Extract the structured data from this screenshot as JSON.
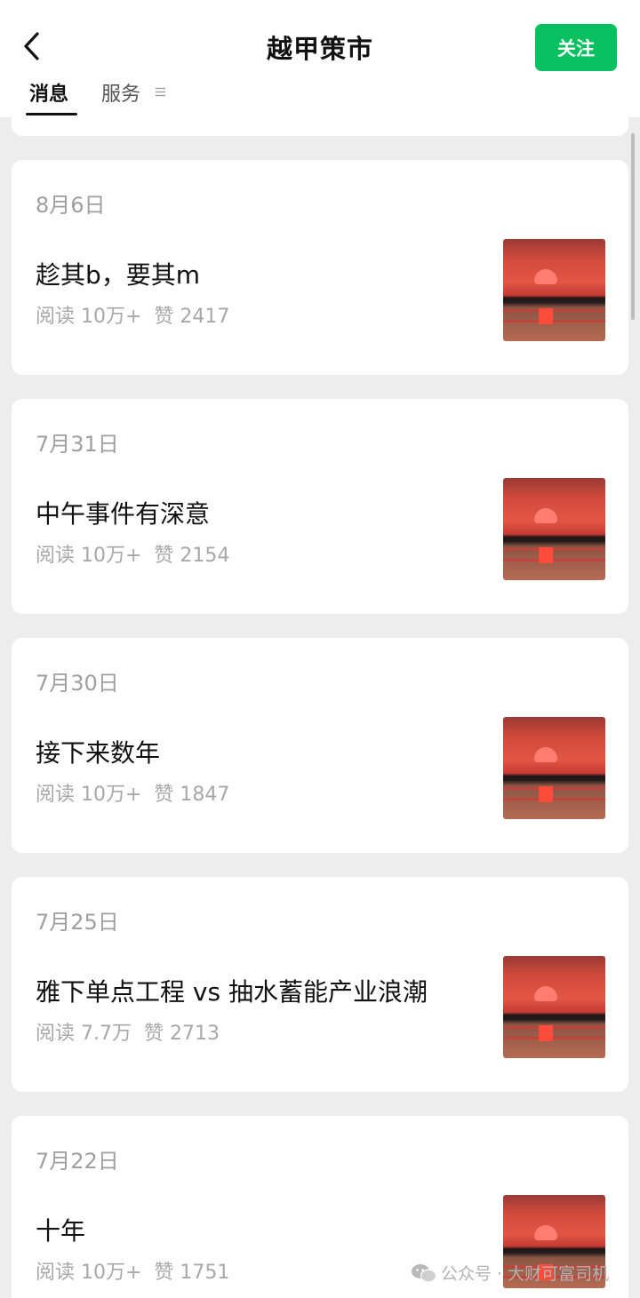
{
  "header": {
    "title": "越甲策市",
    "follow_label": "关注",
    "icons": {
      "back": "chevron-left-icon",
      "menu": "menu-lines-icon"
    }
  },
  "tabs": [
    {
      "label": "消息",
      "active": true
    },
    {
      "label": "服务",
      "active": false
    }
  ],
  "articles": [
    {
      "date": "8月6日",
      "title": "趁其b，要其m",
      "reads": "阅读 10万+",
      "likes": "赞 2417"
    },
    {
      "date": "7月31日",
      "title": "中午事件有深意",
      "reads": "阅读 10万+",
      "likes": "赞 2154"
    },
    {
      "date": "7月30日",
      "title": "接下来数年",
      "reads": "阅读 10万+",
      "likes": "赞 1847"
    },
    {
      "date": "7月25日",
      "title": "雅下单点工程 vs 抽水蓄能产业浪潮",
      "reads": "阅读 7.7万",
      "likes": "赞 2713"
    },
    {
      "date": "7月22日",
      "title": "十年",
      "reads": "阅读 10万+",
      "likes": "赞 1751"
    }
  ],
  "watermark": {
    "text": "公众号 · 大财可富司机",
    "icon": "wechat-icon"
  },
  "colors": {
    "accent": "#07c160",
    "background": "#ededed"
  }
}
